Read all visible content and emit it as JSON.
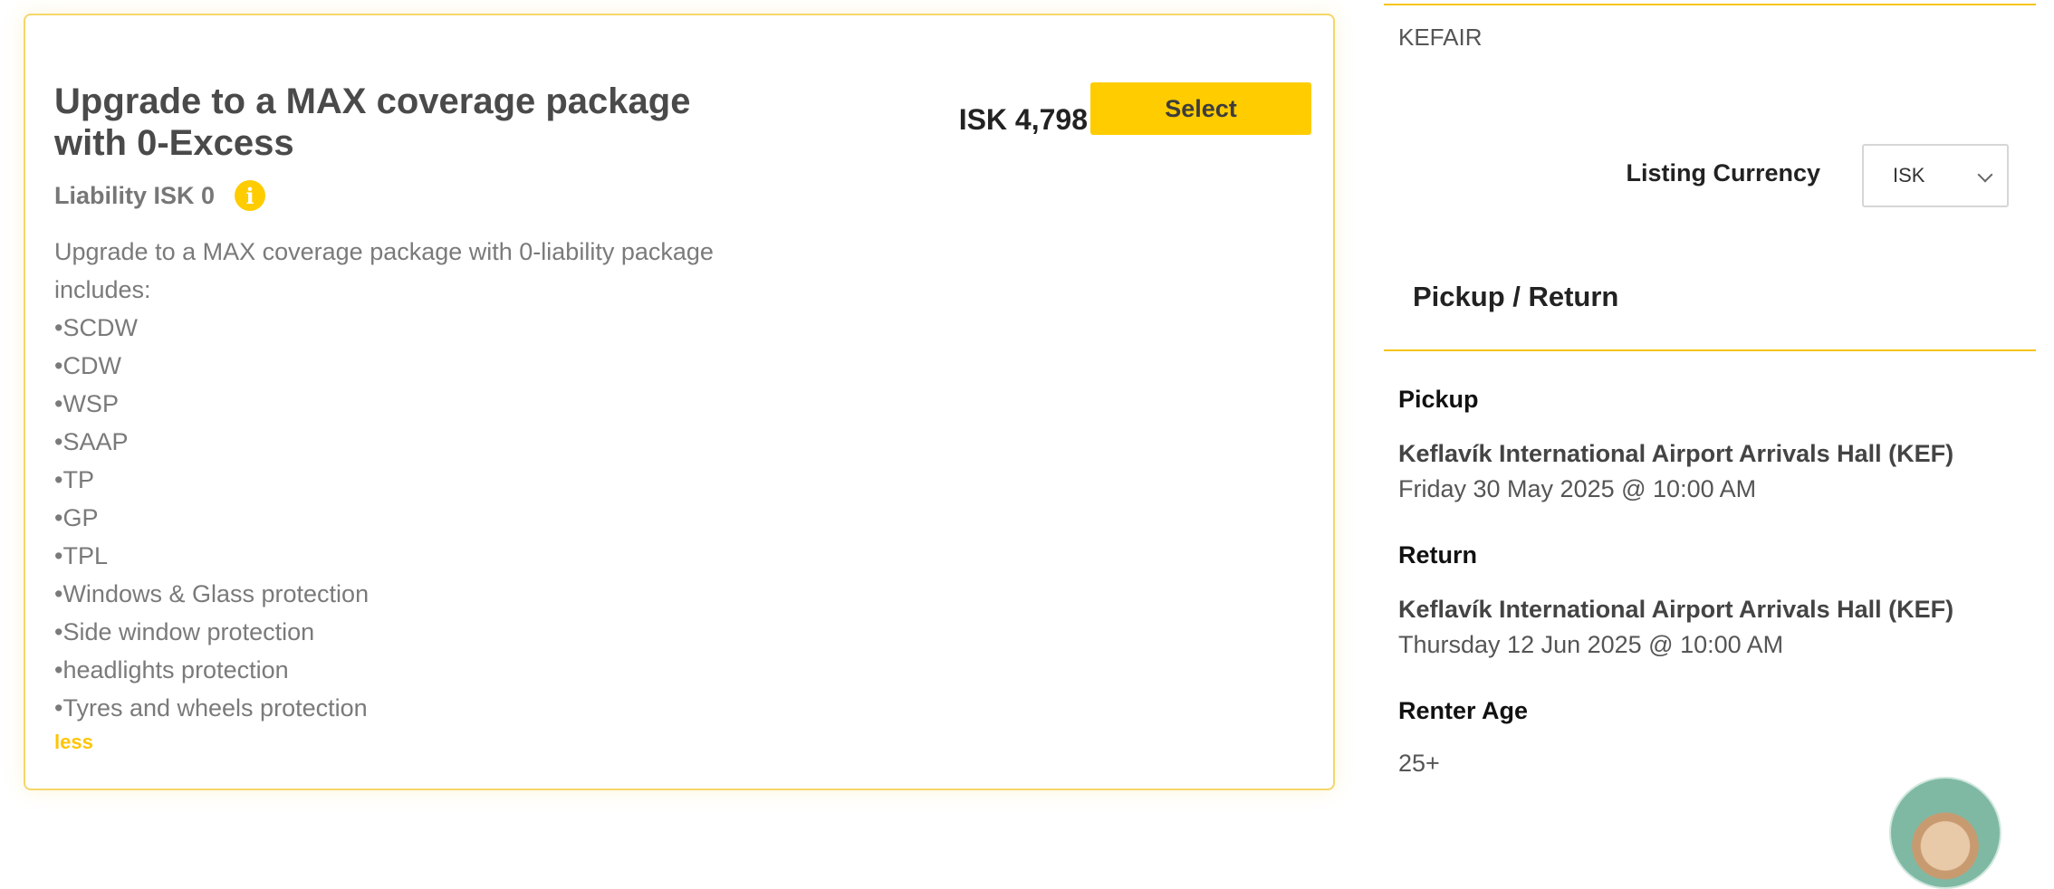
{
  "package": {
    "title": "Upgrade to a MAX coverage package with 0-Excess",
    "price": "ISK 4,798",
    "select_label": "Select",
    "liability": "Liability ISK 0",
    "description": "Upgrade to a MAX coverage package with 0-liability package includes:",
    "features": [
      "•SCDW",
      "•CDW",
      "•WSP",
      "•SAAP",
      "•TP",
      "•GP",
      "•TPL",
      "•Windows & Glass protection",
      "•Side window protection",
      "•headlights protection",
      "•Tyres and wheels protection"
    ],
    "less_label": "less",
    "info_icon": "info-icon"
  },
  "sidebar": {
    "agent_code": "KEFAIR",
    "currency_label": "Listing Currency",
    "currency_value": "ISK",
    "section_title": "Pickup / Return",
    "pickup_label": "Pickup",
    "pickup_location": "Keflavík International Airport Arrivals Hall (KEF)",
    "pickup_datetime": "Friday 30 May 2025 @ 10:00 AM",
    "return_label": "Return",
    "return_location": "Keflavík International Airport Arrivals Hall (KEF)",
    "return_datetime": "Thursday 12 Jun 2025 @ 10:00 AM",
    "renter_age_label": "Renter Age",
    "renter_age_value": "25+"
  },
  "colors": {
    "accent": "#ffcc00",
    "card_border": "#f5d66a",
    "rule": "#f5c518"
  }
}
